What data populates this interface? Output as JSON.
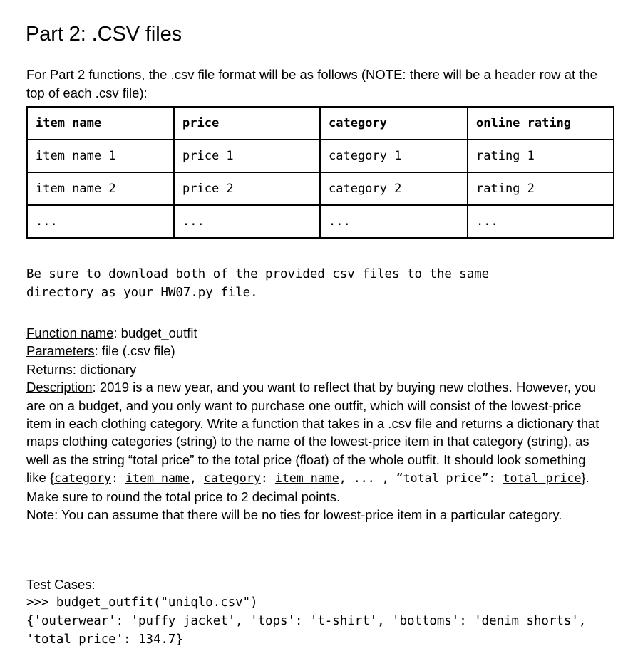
{
  "document": {
    "title": "Part 2: .CSV files",
    "intro": "For Part 2 functions, the .csv file format will be as follows (NOTE: there will be a header row at the top of each .csv file):"
  },
  "csv_table": {
    "headers": [
      "item name",
      "price",
      "category",
      "online rating"
    ],
    "rows": [
      [
        "item name 1",
        "price 1",
        "category 1",
        "rating 1"
      ],
      [
        "item name 2",
        "price 2",
        "category 2",
        "rating 2"
      ],
      [
        "...",
        "...",
        "...",
        "..."
      ]
    ]
  },
  "download_note": "Be sure to download both of the provided csv files to the same directory as your HW07.py file.",
  "spec": {
    "function_name_label": "Function name",
    "function_name_value": ": budget_outfit",
    "parameters_label": "Parameters",
    "parameters_value": ": file (.csv file)",
    "returns_label": "Returns:",
    "returns_value": " dictionary",
    "description_label": "Description",
    "description_part1": ": 2019 is a new year, and you want to reflect that by buying new clothes. However, you are on a budget, and you only want to purchase one outfit, which will consist of the lowest-price item in each clothing category. Write a function that takes in a .csv file and returns a dictionary that maps clothing categories (string) to the name of the lowest-price item in that category (string), as well as the string “total price” to the total price (float) of the whole outfit. It should look something like {",
    "code_category_1": "category",
    "code_colon_1": ": ",
    "code_item_name_1": "item name",
    "code_comma_1": ", ",
    "code_category_2": "category",
    "code_colon_2": ": ",
    "code_item_name_2": "item name",
    "code_ellipsis": ", ... , ",
    "code_total_price_key": "“total price”: ",
    "code_total_price_value": "total price",
    "description_part2": "}. Make sure to round the total price to 2 decimal points.",
    "note_line": "Note: You can assume that there will be no ties for lowest-price item in a particular category."
  },
  "test_cases": {
    "label": "Test Cases:",
    "prompt_line": ">>> budget_outfit(\"uniqlo.csv\")",
    "output_line": "{'outerwear': 'puffy jacket', 'tops': 't-shirt', 'bottoms': 'denim shorts', 'total price': 134.7}"
  }
}
